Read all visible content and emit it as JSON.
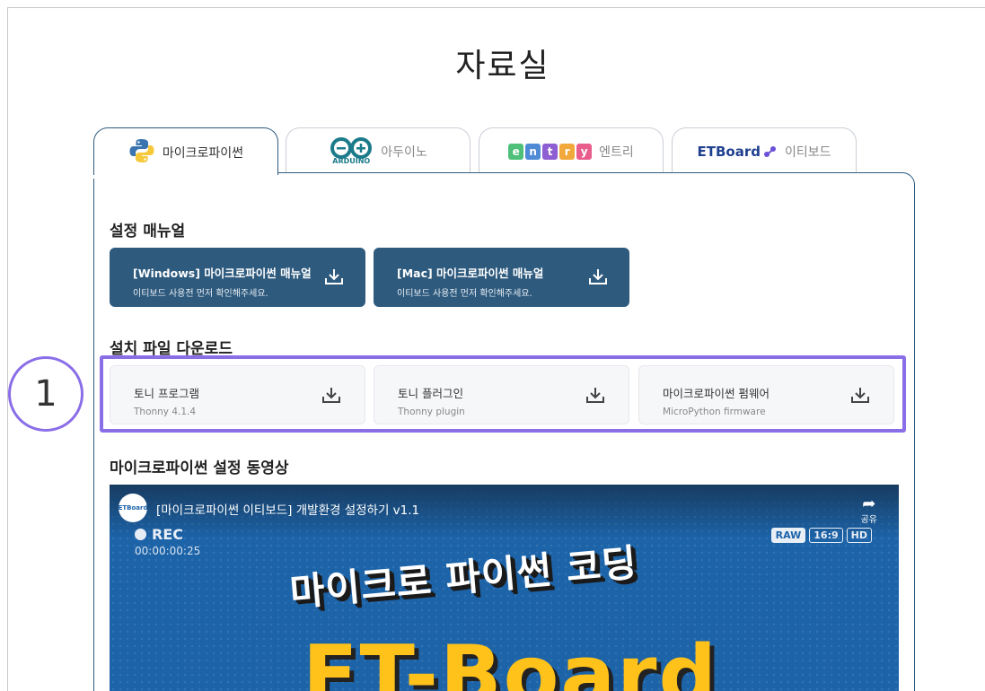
{
  "page": {
    "title": "자료실"
  },
  "tabs": [
    {
      "label": "마이크로파이썬",
      "icon": "python-logo-icon",
      "active": true
    },
    {
      "label": "아두이노",
      "logo_text": "ARDUINO",
      "icon": "arduino-logo-icon",
      "active": false
    },
    {
      "label": "엔트리",
      "logo_letters": [
        "e",
        "n",
        "t",
        "r",
        "y"
      ],
      "icon": "entry-logo-icon",
      "active": false
    },
    {
      "label": "이티보드",
      "logo_text": "ETBoard",
      "icon": "etboard-logo-icon",
      "active": false
    }
  ],
  "manual": {
    "heading": "설정 매뉴얼",
    "buttons": [
      {
        "title": "[Windows] 마이크로파이썬 매뉴얼",
        "subtitle": "이티보드 사용전 먼저 확인해주세요.",
        "icon": "download-icon"
      },
      {
        "title": "[Mac] 마이크로파이썬 매뉴얼",
        "subtitle": "이티보드 사용전 먼저 확인해주세요.",
        "icon": "download-icon"
      }
    ]
  },
  "install": {
    "heading": "설치 파일 다운로드",
    "files": [
      {
        "title": "토니 프로그램",
        "subtitle": "Thonny 4.1.4",
        "icon": "download-icon"
      },
      {
        "title": "토니 플러그인",
        "subtitle": "Thonny plugin",
        "icon": "download-icon"
      },
      {
        "title": "마이크로파이썬 펌웨어",
        "subtitle": "MicroPython firmware",
        "icon": "download-icon"
      }
    ]
  },
  "annotation": {
    "marker": "1",
    "color": "#8a6ee8"
  },
  "video_section": {
    "heading": "마이크로파이썬 설정 동영상",
    "channel_logo_text": "ETBoard",
    "title": "[마이크로파이썬 이티보드] 개발환경 설정하기 v1.1",
    "share_label": "공유",
    "rec_label": "REC",
    "timecode": "00:00:00:25",
    "badges": [
      "RAW",
      "16:9",
      "HD"
    ],
    "headline": "마이크로 파이썬 코딩",
    "brand_text": "ET-Board"
  },
  "colors": {
    "accent": "#2e5a7e",
    "highlight": "#8a6ee8",
    "video_bg": "#1c63a8",
    "brand_yellow": "#ffc21a"
  }
}
